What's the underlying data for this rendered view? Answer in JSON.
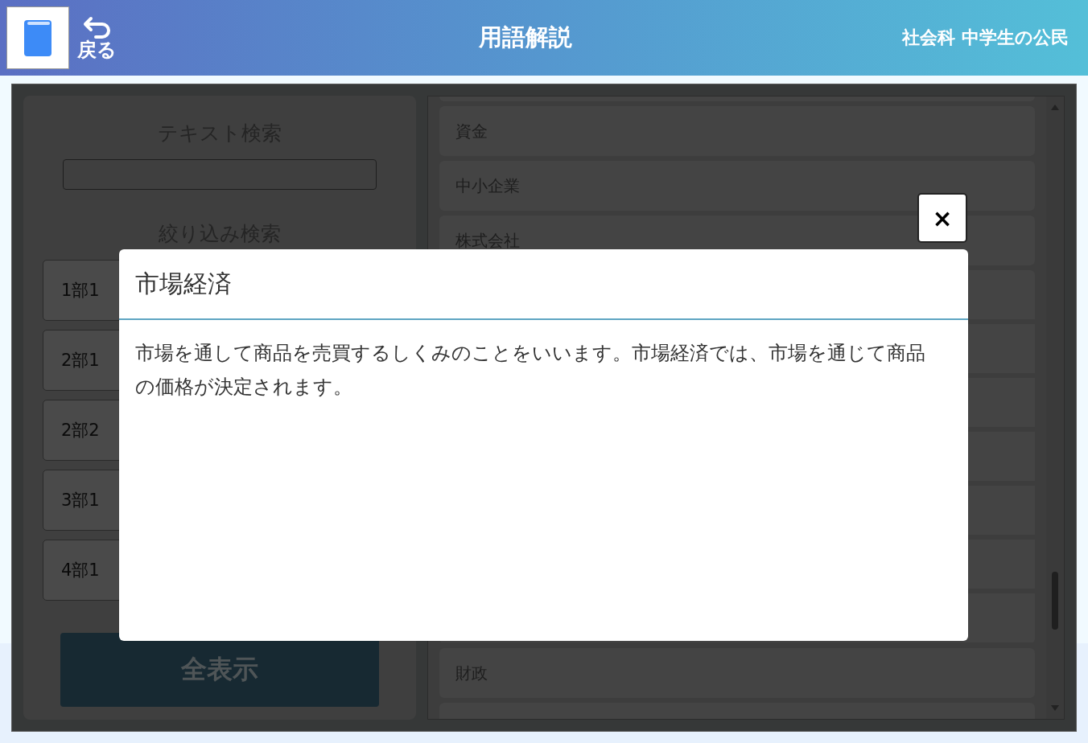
{
  "header": {
    "back_label": "戻る",
    "title": "用語解説",
    "subject": "社会科 中学生の公民"
  },
  "search": {
    "heading": "テキスト検索"
  },
  "filter": {
    "heading": "絞り込み検索",
    "buttons": [
      "1部1",
      "2部1",
      "2部2",
      "3部1",
      "4部1"
    ],
    "show_all": "全表示"
  },
  "terms": {
    "top": [
      "資金",
      "中小企業",
      "株式会社"
    ],
    "bottom": [
      "財政"
    ]
  },
  "dialog": {
    "title": "市場経済",
    "body": "市場を通して商品を売買するしくみのことをいいます。市場経済では、市場を通じて商品の価格が決定されます。",
    "close": "×"
  }
}
